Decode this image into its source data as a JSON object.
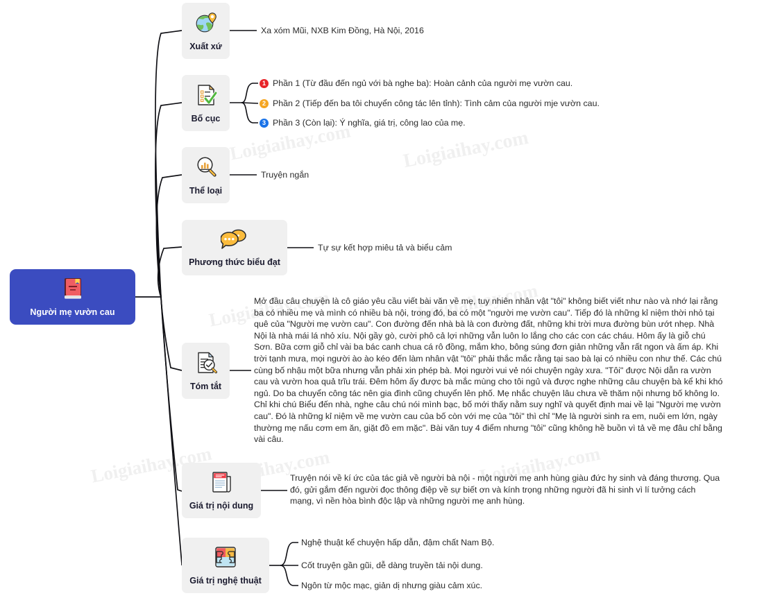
{
  "watermark": {
    "text": "Loigiaihay.com"
  },
  "root": {
    "label": "Người mẹ vườn cau",
    "icon": "book-icon",
    "color": "#3b4cc0"
  },
  "branches": [
    {
      "id": "xuat-xu",
      "label": "Xuất xứ",
      "icon": "globe-pin-icon",
      "leaves": [
        {
          "text": "Xa xóm Mũi, NXB Kim Đồng, Hà Nội, 2016"
        }
      ]
    },
    {
      "id": "bo-cuc",
      "label": "Bố cục",
      "icon": "checklist-icon",
      "numbered": [
        {
          "num": "1",
          "color": "#e8252a",
          "text": "Phần 1 (Từ đầu đến ngủ với bà nghe ba): Hoàn cảnh của người mẹ vườn cau."
        },
        {
          "num": "2",
          "color": "#f5a623",
          "text": "Phần 2 (Tiếp đến ba tôi chuyển công tác lên tỉnh): Tình cảm của người mje vườn cau."
        },
        {
          "num": "3",
          "color": "#1a73e8",
          "text": "Phần 3 (Còn lại): Ý nghĩa, giá trị, công lao của mẹ."
        }
      ]
    },
    {
      "id": "the-loai",
      "label": "Thể loại",
      "icon": "chart-magnifier-icon",
      "leaves": [
        {
          "text": "Truyện ngắn"
        }
      ]
    },
    {
      "id": "phuong-thuc-bieu-dat",
      "label": "Phương thức biểu đạt",
      "icon": "speech-bubbles-icon",
      "leaves": [
        {
          "text": "Tự sự kết hợp miêu tả và biểu cảm"
        }
      ]
    },
    {
      "id": "tom-tat",
      "label": "Tóm tắt",
      "icon": "document-search-icon",
      "paragraph": "Mở đầu câu chuyện là cô giáo yêu cầu viết bài văn về mẹ, tuy nhiên nhân vật \"tôi\" không biết viết như nào và nhớ lại rằng ba có nhiều mẹ và mình có nhiều bà nội, trong đó, ba có một \"người mẹ vườn cau\". Tiếp đó là những kỉ niệm thời nhỏ tại quê của \"Người mẹ vườn cau\". Con đường đến nhà bà là con đường đất, những khi trời mưa đường bùn ướt nhẹp. Nhà Nội là nhà mái lá nhỏ xíu. Nội gầy gò, cười phô cả lợi những vẫn luôn lo lắng cho các con các cháu. Hôm ấy là giỗ chú Sơn. Bữa cơm giỗ chỉ vài ba bác canh chua cá rô đồng, mắm kho, bông súng đơn giản những vẫn rất ngon và ấm áp. Khi trời tạnh mưa, mọi người ào ào kéo đến làm nhân vật \"tôi\" phải thắc mắc rằng tại sao bà lại có nhiều con như thế. Các chú cùng bố nhậu một bữa nhưng vẫn phải xin phép bà. Mọi người vui vẻ nói chuyện ngày xưa. \"Tôi\" được Nội dẫn ra vườn cau và vườn hoa quả trĩu trái. Đêm hôm ấy được bà mắc mùng cho tôi ngủ và được nghe những câu chuyện bà kể khi khó ngủ. Do ba chuyển công tác nên gia đình cũng chuyển lên phố. Mẹ nhắc chuyện lâu chưa về thăm nội nhưng bố không lo. Chỉ khi chú Biểu đến nhà, nghe câu chú nói mình bạc, bố mới thấy nằm suy nghĩ và quyết định mai về lại \"Người mẹ vườn cau\". Đó là những kỉ niệm về mẹ vườn cau của bố còn với mẹ của \"tôi\" thì chỉ \"Mẹ là người sinh ra em, nuôi em lớn, ngày thường mẹ nấu cơm em ăn, giặt đồ em mặc\". Bài văn tuy 4 điểm nhưng \"tôi\" cũng không hề buồn vì tả về mẹ đâu chỉ bằng vài câu."
    },
    {
      "id": "gia-tri-noi-dung",
      "label": "Giá trị nội dung",
      "icon": "newspaper-icon",
      "paragraph": "Truyện nói về kí ức của tác giả về người bà nội - một người mẹ anh hùng giàu đức hy sinh và đáng thương. Qua đó, gửi gắm đến người đọc thông điệp về sự biết ơn và kính trọng những người đã hi sinh vì lí tưởng cách mạng, vì nền hòa bình độc lập và những người mẹ anh hùng."
    },
    {
      "id": "gia-tri-nghe-thuat",
      "label": "Giá trị nghệ thuật",
      "icon": "puzzle-icon",
      "leaves": [
        {
          "text": "Nghệ thuật kể chuyện hấp dẫn, đậm chất Nam Bộ."
        },
        {
          "text": "Cốt truyện gần gũi, dễ dàng truyền tải nội dung."
        },
        {
          "text": "Ngôn từ mộc mạc, giản dị nhưng giàu cảm xúc."
        }
      ]
    }
  ]
}
